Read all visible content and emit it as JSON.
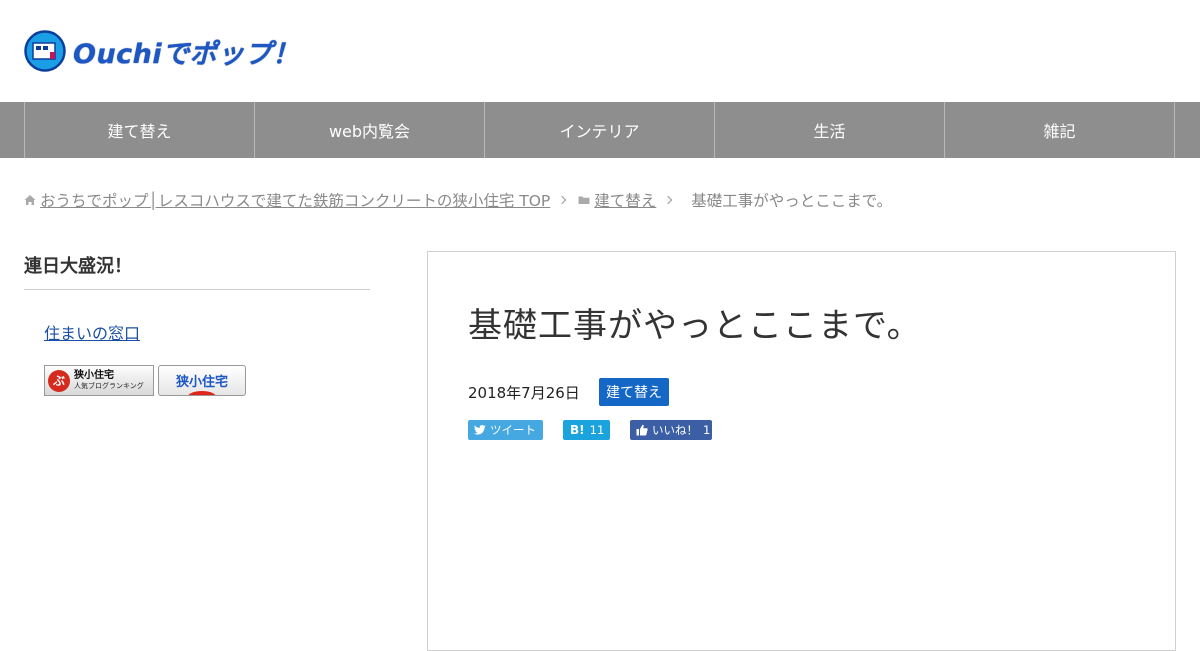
{
  "header": {
    "logo_text": "Ouchiでポップ！"
  },
  "nav": {
    "items": [
      "建て替え",
      "web内覧会",
      "インテリア",
      "生活",
      "雑記"
    ]
  },
  "breadcrumb": {
    "home": "おうちでポップ│レスコハウスで建てた鉄筋コンクリートの狭小住宅 TOP",
    "category": "建て替え",
    "current": "基礎工事がやっとここまで。"
  },
  "sidebar": {
    "title": "連日大盛況！",
    "link": "住まいの窓口",
    "banner1_main": "狭小住宅",
    "banner1_sub": "人気ブログランキング",
    "banner2_text": "狭小住宅"
  },
  "article": {
    "title": "基礎工事がやっとここまで。",
    "date": "2018年7月26日",
    "category": "建て替え",
    "share": {
      "tweet": "ツイート",
      "hatena_count": "11",
      "like": "いいね！",
      "like_count": "1"
    }
  },
  "colors": {
    "brand": "#1d57c4",
    "nav_bg": "#8e8e8e",
    "category_badge": "#1567c5",
    "twitter": "#45a8e0",
    "hatena": "#1ba3dd",
    "facebook": "#3b5ea4"
  }
}
